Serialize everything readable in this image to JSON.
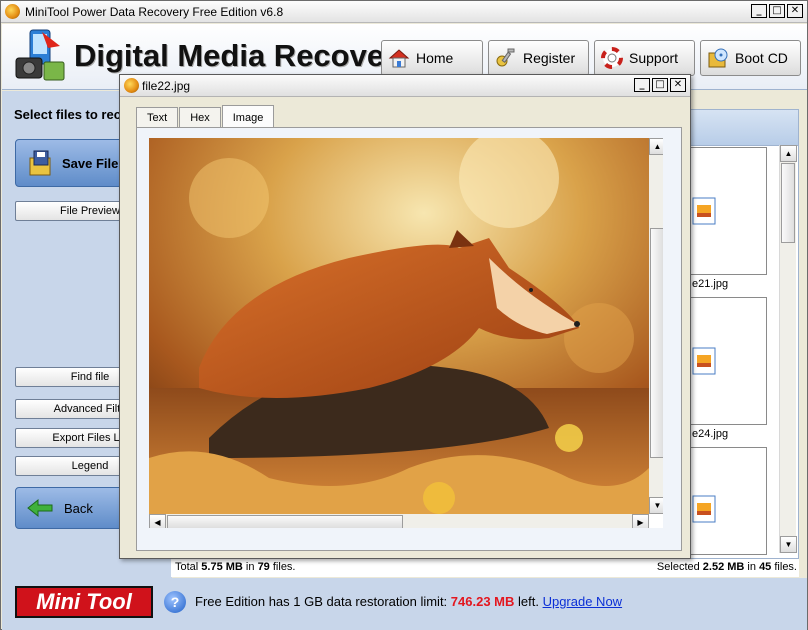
{
  "window": {
    "title": "MiniTool Power Data Recovery Free Edition v6.8",
    "minimize": "_",
    "maximize": "□",
    "close": "✕"
  },
  "header": {
    "brand": "Digital Media Recovery",
    "nav": [
      {
        "label": "Home",
        "icon": "house-icon"
      },
      {
        "label": "Register",
        "icon": "key-icon"
      },
      {
        "label": "Support",
        "icon": "lifebuoy-icon"
      },
      {
        "label": "Boot CD",
        "icon": "boot-cd-icon"
      }
    ]
  },
  "left_panel": {
    "label": "Select files to rec",
    "save_files": "Save Files",
    "file_preview": "File Preview",
    "find_file": "Find file",
    "advanced_filter": "Advanced Filte",
    "export_files_list": "Export Files Lis",
    "legend": "Legend",
    "back": "Back"
  },
  "file_list": {
    "thumbs": [
      {
        "label": "e21.jpg"
      },
      {
        "label": "e24.jpg"
      },
      {
        "label": ""
      }
    ]
  },
  "status": {
    "total_prefix": "Total ",
    "total_size": "5.75 MB",
    "total_mid": " in ",
    "total_count": "79",
    "total_suffix": " files.",
    "selected_prefix": "Selected ",
    "selected_size": "2.52 MB",
    "selected_mid": " in ",
    "selected_count": "45",
    "selected_suffix": " files."
  },
  "footer": {
    "logo": "Mini Tool",
    "text_prefix": "Free Edition has 1 GB data restoration limit: ",
    "remaining": "746.23 MB",
    "text_suffix": " left. ",
    "upgrade": "Upgrade Now"
  },
  "preview_dialog": {
    "title": "file22.jpg",
    "minimize": "_",
    "maximize": "□",
    "close": "✕",
    "tabs": [
      "Text",
      "Hex",
      "Image"
    ],
    "active_tab": "Image"
  },
  "colors": {
    "accent_red": "#e3171f",
    "link_blue": "#0b2fd6",
    "panel_blue": "#c8d6ea"
  }
}
